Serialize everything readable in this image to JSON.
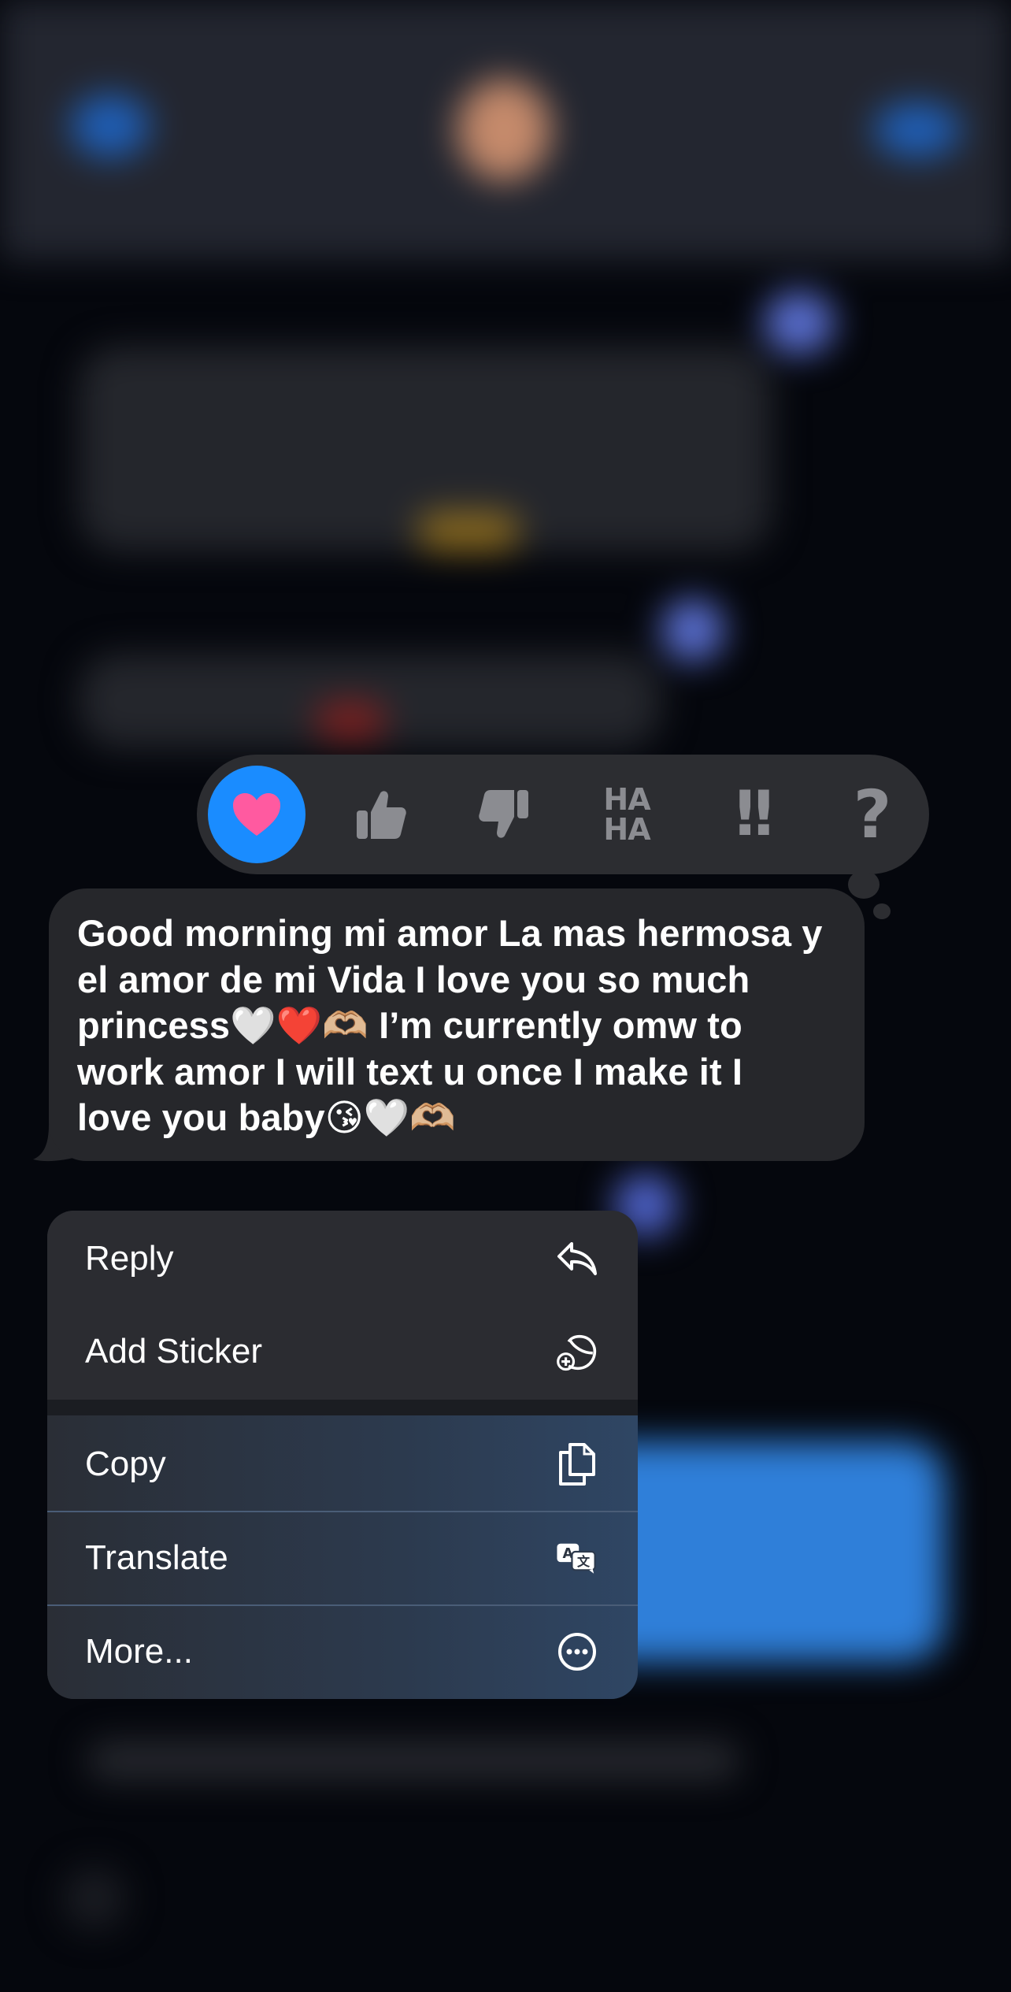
{
  "tapback": {
    "items": [
      {
        "id": "love",
        "icon": "heart-icon",
        "selected": true
      },
      {
        "id": "like",
        "icon": "thumbs-up-icon"
      },
      {
        "id": "dislike",
        "icon": "thumbs-down-icon"
      },
      {
        "id": "laugh",
        "text_top": "HA",
        "text_bottom": "HA"
      },
      {
        "id": "emphasize",
        "text": "!!"
      },
      {
        "id": "question",
        "text": "?"
      }
    ]
  },
  "message": {
    "text": "Good morning mi amor La mas hermosa y\nel amor de mi Vida I love you so much\nprincess🤍❤️🫶🏼 I’m currently omw to\nwork amor I will text u once I make it I\nlove you baby😘🤍🫶🏼"
  },
  "menu": {
    "items": [
      {
        "label": "Reply",
        "icon": "reply-icon"
      },
      {
        "label": "Add Sticker",
        "icon": "add-sticker-icon"
      },
      {
        "label": "Copy",
        "icon": "copy-icon"
      },
      {
        "label": "Translate",
        "icon": "translate-icon"
      },
      {
        "label": "More...",
        "icon": "more-icon"
      }
    ]
  },
  "colors": {
    "accent": "#1a8cff",
    "heart": "#ff5aa0",
    "bubble": "#26272b",
    "tapback_bar": "#2c2d31"
  }
}
